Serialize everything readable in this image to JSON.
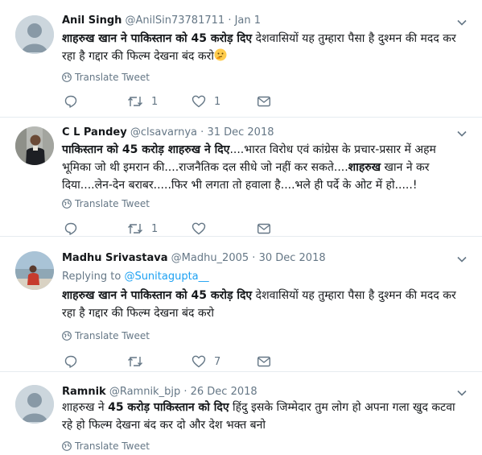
{
  "tweets": [
    {
      "name": "Anil Singh",
      "handle": "@AnilSin73781711",
      "dot": "·",
      "date": "Jan 1",
      "text_b1": "शाहरुख खान ने पाकिस्तान को 45 करोड़ दिए",
      "text_r1": " देशवासियों यह तुम्हारा पैसा है दुश्मन की मदद कर रहा है गद्दार की फिल्म देखना बंद करो",
      "emoji": "thinking-face",
      "translate": "Translate Tweet",
      "reply_count": "",
      "retweet_count": "1",
      "like_count": "1"
    },
    {
      "name": "C L Pandey",
      "handle": "@clsavarnya",
      "dot": "·",
      "date": "31 Dec 2018",
      "text_b1": "पाकिस्तान को 45 करोड़ शाहरुख ने दिए",
      "text_r1": "....भारत विरोध एवं कांग्रेस के प्रचार-प्रसार में अहम भूमिका जो थी इमरान की....राजनैतिक दल सीधे जो नहीं कर सकते....",
      "text_b2": "शाहरुख",
      "text_r2": " खान ने कर दिया....लेन-देन बराबर.....फिर भी लगता तो हवाला है....भले ही पर्दे के ओट में हो.....!",
      "translate": "Translate Tweet",
      "reply_count": "",
      "retweet_count": "1",
      "like_count": ""
    },
    {
      "name": "Madhu Srivastava",
      "handle": "@Madhu_2005",
      "dot": "·",
      "date": "30 Dec 2018",
      "replying_label": "Replying to ",
      "replying_handle": "@Sunitagupta__",
      "text_b1": "शाहरुख खान ने पाकिस्तान को 45 करोड़ दिए",
      "text_r1": " देशवासियों यह तुम्हारा पैसा है दुश्मन की मदद कर रहा है गद्दार की फिल्म देखना बंद करो",
      "translate": "Translate Tweet",
      "reply_count": "",
      "retweet_count": "",
      "like_count": "7"
    },
    {
      "name": "Ramnik",
      "handle": "@Ramnik_bjp",
      "dot": "·",
      "date": "26 Dec 2018",
      "text_r0": "शाहरुख ने ",
      "text_b1": "45 करोड़ पाकिस्तान को दिए",
      "text_r1": " हिंदु इसके जिम्मेदार तुम लोग हो अपना गला खुद कटवा रहे हो फिल्म देखना बंद कर दो और देश भक्त बनो",
      "translate": "Translate Tweet"
    }
  ],
  "colors": {
    "text": "#14171a",
    "secondary": "#657786",
    "link": "#1da1f2",
    "border": "#e6ecf0"
  }
}
